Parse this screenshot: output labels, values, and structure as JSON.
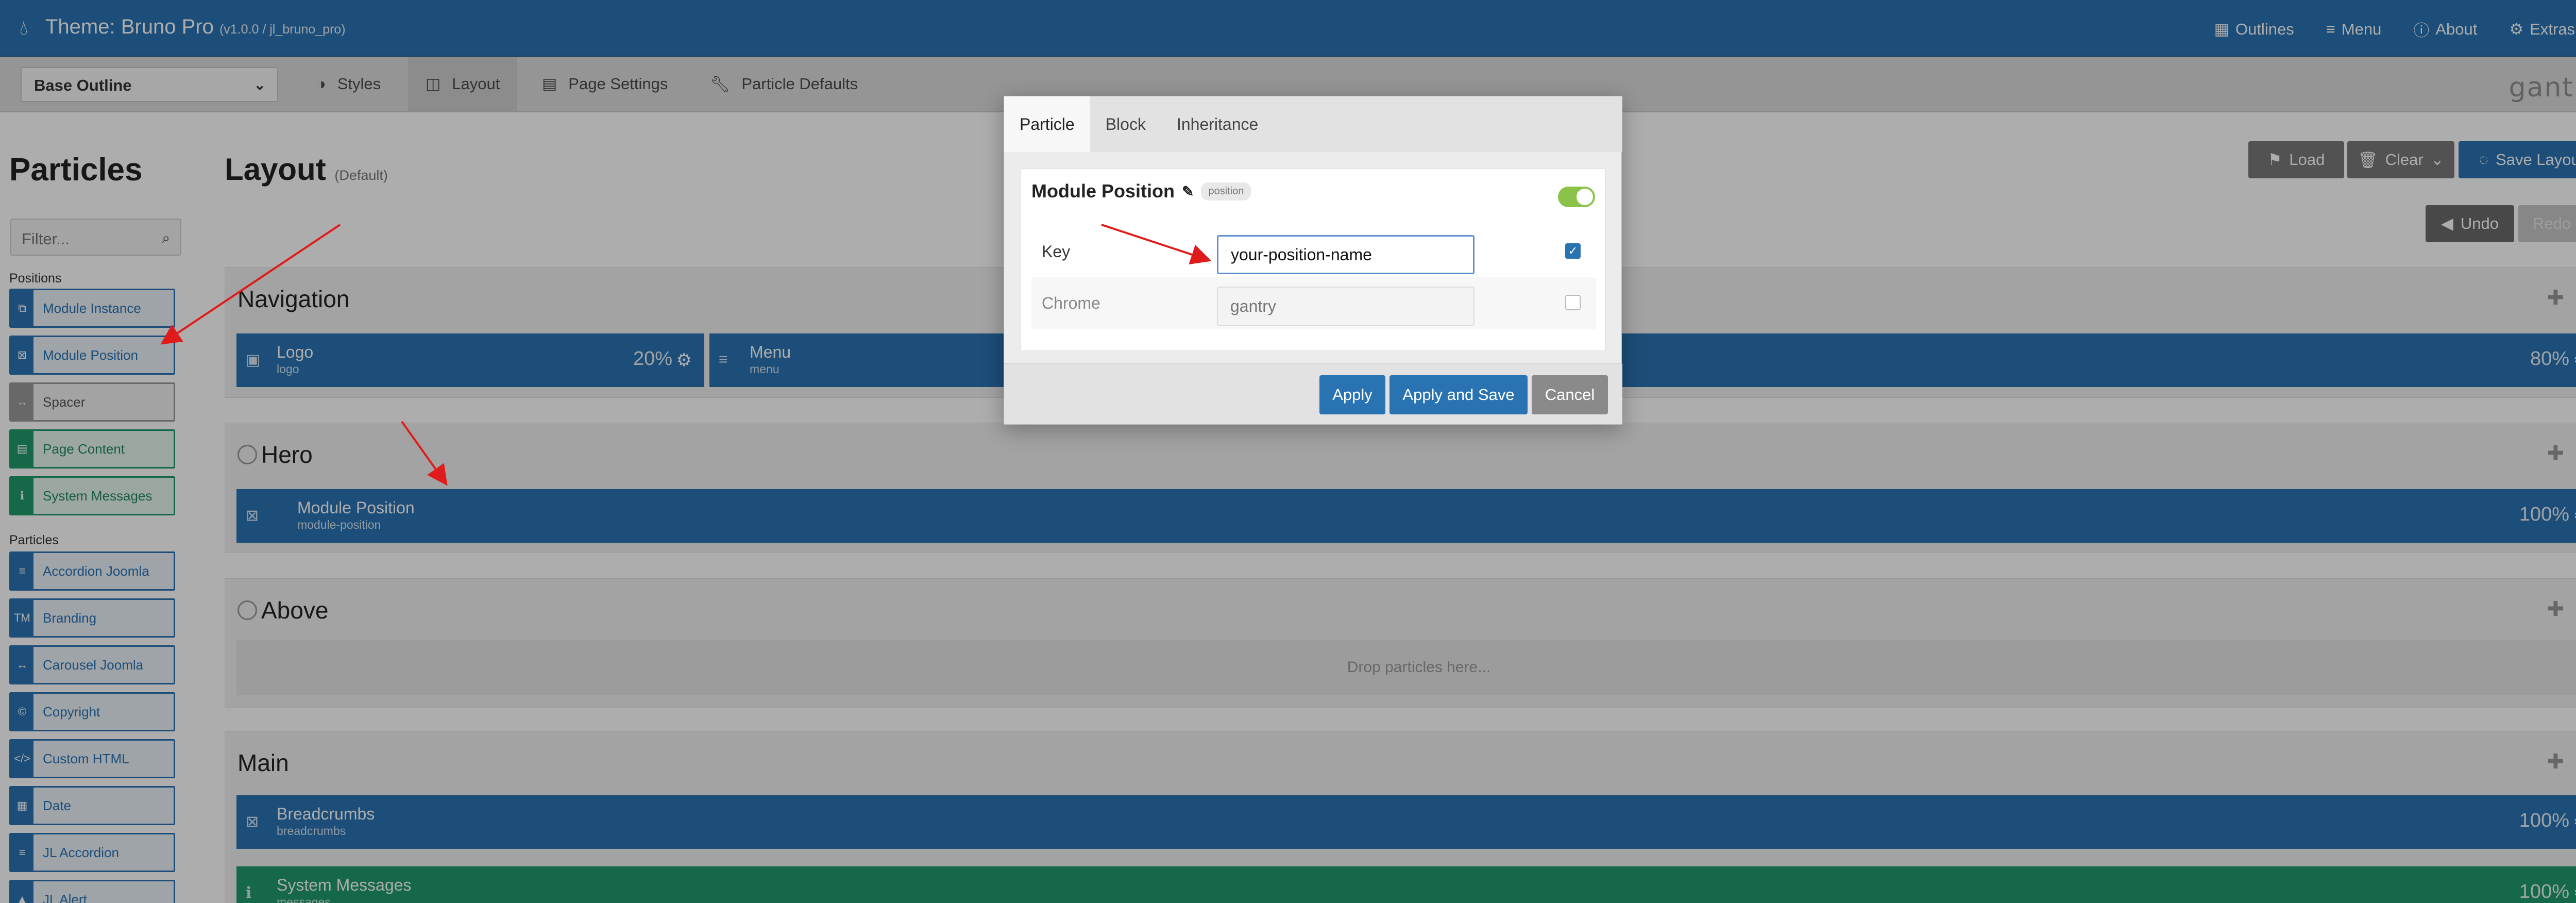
{
  "header": {
    "title": "Theme: Bruno Pro",
    "version": "(v1.0.0 / jl_bruno_pro)",
    "nav": [
      {
        "label": "Outlines",
        "icon": "grid-icon"
      },
      {
        "label": "Menu",
        "icon": "bars-icon"
      },
      {
        "label": "About",
        "icon": "info-icon"
      },
      {
        "label": "Extras",
        "icon": "gear-icon"
      }
    ]
  },
  "toolbar": {
    "outline_select": "Base Outline",
    "tabs": [
      {
        "label": "Styles"
      },
      {
        "label": "Layout"
      },
      {
        "label": "Page Settings"
      },
      {
        "label": "Particle Defaults"
      }
    ],
    "brand": "gantry"
  },
  "sidebar": {
    "title": "Particles",
    "filter_placeholder": "Filter...",
    "positions_label": "Positions",
    "positions": [
      {
        "label": "Module Instance",
        "color": "blue"
      },
      {
        "label": "Module Position",
        "color": "blue"
      },
      {
        "label": "Spacer",
        "color": "gray"
      },
      {
        "label": "Page Content",
        "color": "green"
      },
      {
        "label": "System Messages",
        "color": "green"
      }
    ],
    "particles_label": "Particles",
    "particles": [
      {
        "label": "Accordion Joomla",
        "glyph": "≡"
      },
      {
        "label": "Branding",
        "glyph": "TM"
      },
      {
        "label": "Carousel Joomla",
        "glyph": "↔"
      },
      {
        "label": "Copyright",
        "glyph": "©"
      },
      {
        "label": "Custom HTML",
        "glyph": "</>"
      },
      {
        "label": "Date",
        "glyph": "▦"
      },
      {
        "label": "JL Accordion",
        "glyph": "≡"
      },
      {
        "label": "JL Alert",
        "glyph": "▲"
      }
    ]
  },
  "layout": {
    "title": "Layout",
    "subtitle": "(Default)",
    "buttons": {
      "load": "Load",
      "clear": "Clear",
      "save": "Save Layout",
      "undo": "Undo",
      "redo": "Redo"
    },
    "sections": {
      "navigation": {
        "title": "Navigation",
        "logo": {
          "title": "Logo",
          "sub": "logo",
          "size": "20%"
        },
        "menu": {
          "title": "Menu",
          "sub": "menu",
          "size": "80%"
        }
      },
      "hero": {
        "title": "Hero",
        "item": {
          "title": "Module Position",
          "sub": "module-position",
          "size": "100%"
        }
      },
      "above": {
        "title": "Above",
        "drop": "Drop particles here..."
      },
      "main": {
        "title": "Main",
        "breadcrumbs": {
          "title": "Breadcrumbs",
          "sub": "breadcrumbs",
          "size": "100%"
        },
        "messages": {
          "title": "System Messages",
          "sub": "messages",
          "size": "100%"
        }
      }
    }
  },
  "modal": {
    "tabs": [
      "Particle",
      "Block",
      "Inheritance"
    ],
    "heading": "Module Position",
    "tag": "position",
    "fields": {
      "key_label": "Key",
      "key_value": "your-position-name",
      "chrome_label": "Chrome",
      "chrome_placeholder": "gantry"
    },
    "buttons": {
      "apply": "Apply",
      "apply_save": "Apply and Save",
      "cancel": "Cancel"
    }
  },
  "colors": {
    "primary": "#2a73b3",
    "green": "#1f9a6a",
    "toggle": "#8bc34a",
    "arrow": "#e01b1b"
  }
}
